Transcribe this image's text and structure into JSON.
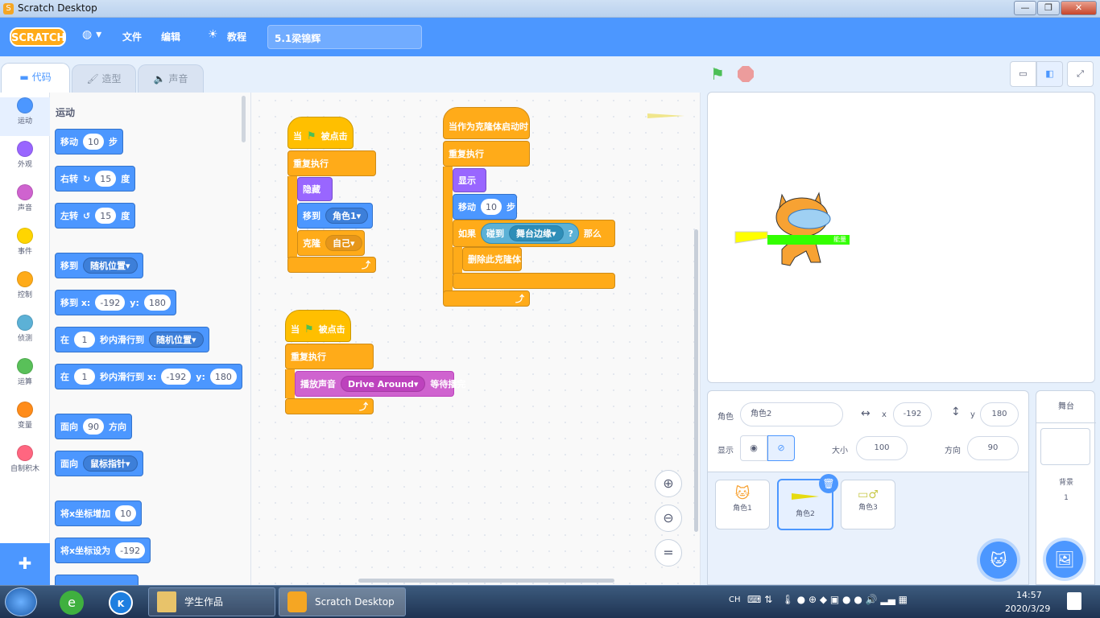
{
  "window": {
    "title": "Scratch Desktop"
  },
  "menubar": {
    "logo": "SCRATCH",
    "globe": "◍ ▾",
    "file": "文件",
    "edit": "编辑",
    "tutorials": "教程",
    "project_name": "5.1梁锦辉"
  },
  "tabs": {
    "code": "代码",
    "costumes": "造型",
    "sounds": "声音"
  },
  "categories": [
    {
      "label": "运动",
      "color": "#4c97ff"
    },
    {
      "label": "外观",
      "color": "#9966ff"
    },
    {
      "label": "声音",
      "color": "#cf63cf"
    },
    {
      "label": "事件",
      "color": "#ffd500"
    },
    {
      "label": "控制",
      "color": "#ffab19"
    },
    {
      "label": "侦测",
      "color": "#5cb1d6"
    },
    {
      "label": "运算",
      "color": "#59c059"
    },
    {
      "label": "变量",
      "color": "#ff8c1a"
    },
    {
      "label": "自制积木",
      "color": "#ff6680"
    }
  ],
  "palette": {
    "heading": "运动",
    "move": {
      "a": "移动",
      "n": "10",
      "b": "步"
    },
    "turn_right": {
      "a": "右转",
      "n": "15",
      "b": "度"
    },
    "turn_left": {
      "a": "左转",
      "n": "15",
      "b": "度"
    },
    "goto": {
      "a": "移到",
      "d": "随机位置"
    },
    "goto_xy": {
      "a": "移到 x:",
      "x": "-192",
      "b": "y:",
      "y": "180"
    },
    "glide": {
      "a": "在",
      "n": "1",
      "b": "秒内滑行到",
      "d": "随机位置"
    },
    "glide_xy": {
      "a": "在",
      "n": "1",
      "b": "秒内滑行到 x:",
      "x": "-192",
      "c": "y:",
      "y": "180"
    },
    "point_dir": {
      "a": "面向",
      "n": "90",
      "b": "方向"
    },
    "point_towards": {
      "a": "面向",
      "d": "鼠标指针"
    },
    "change_x": {
      "a": "将x坐标增加",
      "n": "10"
    },
    "set_x": {
      "a": "将x坐标设为",
      "n": "-192"
    }
  },
  "script1": {
    "hat": "当",
    "hat2": "被点击",
    "forever": "重复执行",
    "hide": "隐藏",
    "goto": "移到",
    "goto_d": "角色1",
    "clone": "克隆",
    "clone_d": "自己"
  },
  "script2": {
    "hat": "当作为克隆体启动时",
    "forever": "重复执行",
    "show": "显示",
    "move": "移动",
    "move_n": "10",
    "move_b": "步",
    "if": "如果",
    "touch": "碰到",
    "touch_d": "舞台边缘",
    "q": "?",
    "then": "那么",
    "delete": "删除此克隆体"
  },
  "script3": {
    "hat": "当",
    "hat2": "被点击",
    "forever": "重复执行",
    "play": "播放声音",
    "play_d": "Drive Around",
    "play_b": "等待播完"
  },
  "stage": {
    "sprite_label": "能量"
  },
  "sprite_info": {
    "sprite_label": "角色",
    "sprite_name": "角色2",
    "x_label": "x",
    "x": "-192",
    "y_label": "y",
    "y": "180",
    "show_label": "显示",
    "size_label": "大小",
    "size": "100",
    "dir_label": "方向",
    "dir": "90"
  },
  "sprites": [
    {
      "name": "角色1"
    },
    {
      "name": "角色2"
    },
    {
      "name": "角色3"
    }
  ],
  "stage_pane": {
    "title": "舞台",
    "backdrops_label": "背景",
    "backdrops_count": "1"
  },
  "taskbar": {
    "task1": "学生作品",
    "task2": "Scratch Desktop",
    "lang": "CH",
    "time": "14:57",
    "date": "2020/3/29"
  }
}
